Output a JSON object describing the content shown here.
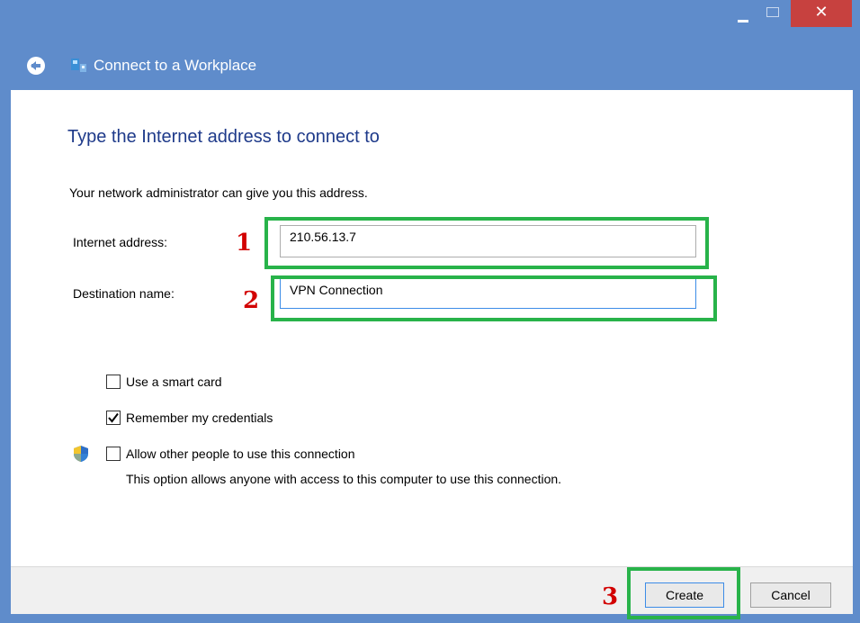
{
  "window": {
    "title": "Connect to a Workplace",
    "controls": {
      "minimize": "minimize",
      "maximize": "maximize",
      "close": "✕"
    }
  },
  "heading": "Type the Internet address to connect to",
  "intro": "Your network administrator can give you this address.",
  "fields": {
    "internet_address": {
      "label": "Internet address:",
      "value": "210.56.13.7"
    },
    "destination_name": {
      "label": "Destination name:",
      "value": "VPN Connection"
    }
  },
  "options": [
    {
      "label": "Use a smart card",
      "checked": false
    },
    {
      "label": "Remember my credentials",
      "checked": true
    },
    {
      "label": "Allow other people to use this connection",
      "checked": false
    }
  ],
  "allow_hint": "This option allows anyone with access to this computer to use this connection.",
  "annotations": {
    "step1": "1",
    "step2": "2",
    "step3": "3"
  },
  "buttons": {
    "create": "Create",
    "cancel": "Cancel"
  },
  "colors": {
    "frame": "#5f8ccb",
    "highlight": "#28b34a",
    "step_number": "#d20000",
    "heading": "#1e3a8a"
  },
  "icons": [
    "back-arrow-icon",
    "network-icon",
    "shield-icon",
    "checkmark-icon"
  ]
}
